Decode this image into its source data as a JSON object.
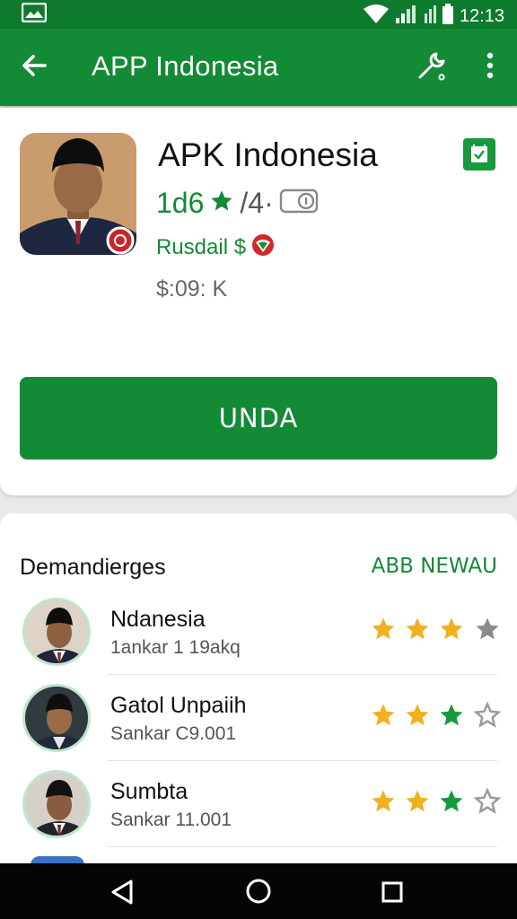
{
  "status_bar": {
    "time": "12:13"
  },
  "app_bar": {
    "title": "APP Indonesia"
  },
  "app": {
    "name": "APK Indonesia",
    "rating": "1d6",
    "rating_extra": "/4·",
    "developer": "Rusdail $",
    "price": "$:09: K",
    "install_label": "UNDA"
  },
  "reviews_section": {
    "title": "Demandierges",
    "action": "ABB NEWAU",
    "items": [
      {
        "name": "Ndanesia",
        "sub": "1ankar 1 19akq",
        "stars": [
          "gold",
          "gold",
          "gold",
          "gray"
        ]
      },
      {
        "name": "Gatol Unpaiih",
        "sub": "Sankar C9.001",
        "stars": [
          "gold",
          "gold",
          "green",
          "gray"
        ]
      },
      {
        "name": "Sumbta",
        "sub": "Sankar 11.001",
        "stars": [
          "gold",
          "gold",
          "green",
          "gray"
        ]
      }
    ]
  },
  "colors": {
    "primary": "#138a36",
    "status_bar": "#0e7a2e",
    "star_gold": "#f2b01e",
    "star_green": "#169a3d",
    "star_gray": "#8a8a8a"
  },
  "icons": [
    "gallery-icon",
    "wifi-icon",
    "signal-icon",
    "battery-icon",
    "back-arrow-icon",
    "wrench-icon",
    "more-vert-icon",
    "check-calendar-icon",
    "star-icon",
    "info-icon",
    "dev-badge-icon",
    "nav-back-icon",
    "nav-home-icon",
    "nav-recent-icon"
  ]
}
